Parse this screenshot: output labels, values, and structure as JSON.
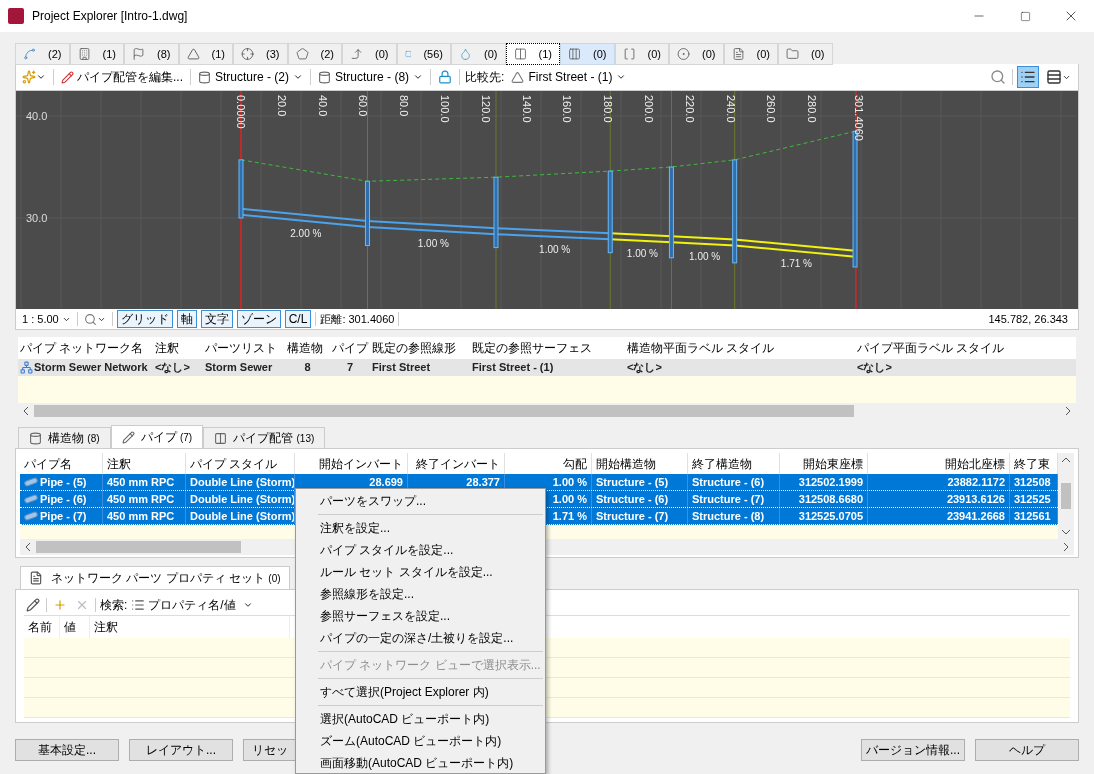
{
  "window": {
    "title": "Project Explorer [Intro-1.dwg]"
  },
  "object_tabs": [
    {
      "count": "(2)",
      "selected": false,
      "highlighted": false
    },
    {
      "count": "(1)",
      "selected": false,
      "highlighted": false
    },
    {
      "count": "(8)",
      "selected": false,
      "highlighted": false
    },
    {
      "count": "(1)",
      "selected": false,
      "highlighted": false
    },
    {
      "count": "(3)",
      "selected": false,
      "highlighted": false
    },
    {
      "count": "(2)",
      "selected": false,
      "highlighted": false
    },
    {
      "count": "(0)",
      "selected": false,
      "highlighted": false
    },
    {
      "count": "(56)",
      "selected": false,
      "highlighted": false
    },
    {
      "count": "(0)",
      "selected": false,
      "highlighted": false
    },
    {
      "count": "(1)",
      "selected": true,
      "highlighted": false
    },
    {
      "count": "(0)",
      "selected": false,
      "highlighted": true
    },
    {
      "count": "(0)",
      "selected": false,
      "highlighted": false
    },
    {
      "count": "(0)",
      "selected": false,
      "highlighted": false
    },
    {
      "count": "(0)",
      "selected": false,
      "highlighted": false
    },
    {
      "count": "(0)",
      "selected": false,
      "highlighted": false
    }
  ],
  "toolbar": {
    "edit_button": "パイプ配管を編集...",
    "structure_dropdowns": [
      "Structure - (2)",
      "Structure - (8)"
    ],
    "compare_label": "比較先:",
    "compare_dropdown": "First Street - (1)",
    "views": [
      {
        "selected": true
      },
      {
        "selected": false
      }
    ]
  },
  "profile": {
    "elevation_labels": [
      "40.0",
      "30.0"
    ],
    "station_labels": [
      "0.0000",
      "20.0",
      "40.0",
      "60.0",
      "80.0",
      "100.0",
      "120.0",
      "140.0",
      "160.0",
      "180.0",
      "200.0",
      "220.0",
      "240.0",
      "260.0",
      "280.0",
      "301.4060"
    ],
    "slope_labels": [
      "2.00 %",
      "1.00 %",
      "1.00 %",
      "1.00 %",
      "1.00 %",
      "1.71 %"
    ]
  },
  "profile_status": {
    "scale": "1 : 5.00",
    "toggles": [
      {
        "label": "グリッド",
        "on": true
      },
      {
        "label": "軸",
        "on": true
      },
      {
        "label": "文字",
        "on": true
      },
      {
        "label": "ゾーン",
        "on": true
      },
      {
        "label": "C/L",
        "on": true
      }
    ],
    "distance": "距離: 301.4060",
    "coordinates": "145.782, 26.343"
  },
  "network_table": {
    "columns": [
      "パイプ ネットワーク名",
      "注釈",
      "パーツリスト",
      "構造物",
      "パイプ",
      "既定の参照線形",
      "既定の参照サーフェス",
      "構造物平面ラベル スタイル",
      "パイプ平面ラベル スタイル"
    ],
    "rows": [
      {
        "selected": false,
        "cells": [
          "Storm Sewer Network",
          "<なし>",
          "Storm Sewer",
          "8",
          "7",
          "First Street",
          "First Street - (1)",
          "<なし>",
          "<なし>"
        ]
      }
    ]
  },
  "part_tabs": [
    {
      "label": "構造物",
      "count": "(8)",
      "selected": false
    },
    {
      "label": "パイプ",
      "count": "(7)",
      "selected": true
    },
    {
      "label": "パイプ配管",
      "count": "(13)",
      "selected": false
    }
  ],
  "pipe_table": {
    "columns": [
      "パイプ名",
      "注釈",
      "パイプ スタイル",
      "開始インバート",
      "終了インバート",
      "勾配",
      "開始構造物",
      "終了構造物",
      "開始東座標",
      "開始北座標",
      "終了東"
    ],
    "rows": [
      {
        "selected": true,
        "cells": [
          "Pipe - (5)",
          "450 mm RPC",
          "Double Line (Storm)",
          "28.699",
          "28.377",
          "1.00 %",
          "Structure - (5)",
          "Structure - (6)",
          "312502.1999",
          "23882.1172",
          "312508"
        ]
      },
      {
        "selected": true,
        "cells": [
          "Pipe - (6)",
          "450 mm RPC",
          "Double Line (Storm)",
          null,
          null,
          "1.00 %",
          "Structure - (6)",
          "Structure - (7)",
          "312508.6680",
          "23913.6126",
          "312525"
        ]
      },
      {
        "selected": true,
        "cells": [
          "Pipe - (7)",
          "450 mm RPC",
          "Double Line (Storm)",
          null,
          null,
          "1.71 %",
          "Structure - (7)",
          "Structure - (8)",
          "312525.0705",
          "23941.2668",
          "312561"
        ]
      }
    ]
  },
  "property_panel": {
    "tab": {
      "label": "ネットワーク パーツ プロパティ セット",
      "count": "(0)"
    },
    "search_label": "検索:",
    "search_dropdown": "プロパティ名/値",
    "columns": [
      "名前",
      "値",
      "注釈"
    ]
  },
  "buttons": [
    "基本設定...",
    "レイアウト...",
    "リセッ",
    "バージョン情報...",
    "ヘルプ"
  ],
  "context_menu": [
    {
      "kind": "item",
      "label": "パーツをスワップ...",
      "disabled": false
    },
    {
      "kind": "separator"
    },
    {
      "kind": "item",
      "label": "注釈を設定...",
      "disabled": false
    },
    {
      "kind": "item",
      "label": "パイプ スタイルを設定...",
      "disabled": false
    },
    {
      "kind": "item",
      "label": "ルール セット スタイルを設定...",
      "disabled": false
    },
    {
      "kind": "item",
      "label": "参照線形を設定...",
      "disabled": false
    },
    {
      "kind": "item",
      "label": "参照サーフェスを設定...",
      "disabled": false
    },
    {
      "kind": "item",
      "label": "パイプの一定の深さ/土被りを設定...",
      "disabled": false
    },
    {
      "kind": "separator"
    },
    {
      "kind": "item",
      "label": "パイプ ネットワーク ビューで選択表示...",
      "disabled": true
    },
    {
      "kind": "separator"
    },
    {
      "kind": "item",
      "label": "すべて選択(Project Explorer 内)",
      "disabled": false
    },
    {
      "kind": "separator"
    },
    {
      "kind": "item",
      "label": "選択(AutoCAD ビューポート内)",
      "disabled": false
    },
    {
      "kind": "item",
      "label": "ズーム(AutoCAD ビューポート内)",
      "disabled": false
    },
    {
      "kind": "item",
      "label": "画面移動(AutoCAD ビューポート内)",
      "disabled": false
    }
  ]
}
